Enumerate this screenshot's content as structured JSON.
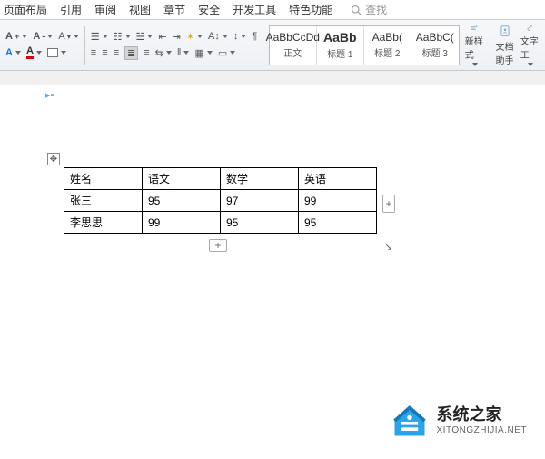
{
  "tabs": {
    "t0": "页面布局",
    "t1": "引用",
    "t2": "审阅",
    "t3": "视图",
    "t4": "章节",
    "t5": "安全",
    "t6": "开发工具",
    "t7": "特色功能"
  },
  "search_placeholder": "查找",
  "styles": {
    "s0_preview": "AaBbCcDd",
    "s0_label": "正文",
    "s1_preview": "AaBb",
    "s1_label": "标题 1",
    "s2_preview": "AaBb(",
    "s2_label": "标题 2",
    "s3_preview": "AaBbC(",
    "s3_label": "标题 3"
  },
  "ribbon_buttons": {
    "new_style": "新样式",
    "doc_helper": "文档助手",
    "text_tool": "文字工"
  },
  "table": {
    "headers": [
      "姓名",
      "语文",
      "数学",
      "英语"
    ],
    "rows": [
      {
        "c0": "张三",
        "c1": "95",
        "c2": "97",
        "c3": "99"
      },
      {
        "c0": "李思思",
        "c1": "99",
        "c2": "95",
        "c3": "95"
      }
    ]
  },
  "watermark": {
    "cn": "系统之家",
    "en": "XITONGZHIJIA.NET"
  },
  "icons": {
    "plus": "+",
    "arrows": "✥",
    "resize": "↘"
  }
}
